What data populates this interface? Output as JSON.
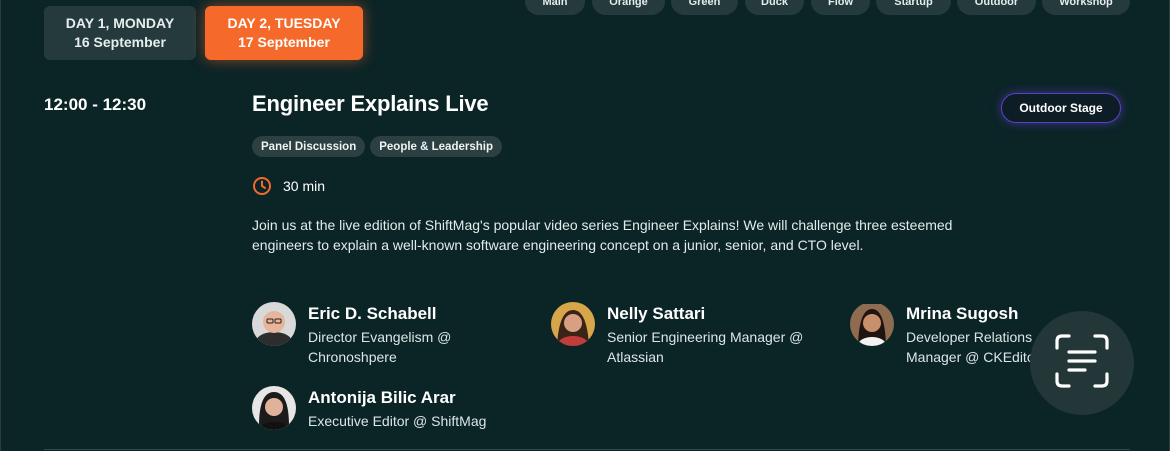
{
  "days": [
    {
      "name": "DAY 1, MONDAY",
      "date": "16 September",
      "active": false
    },
    {
      "name": "DAY 2, TUESDAY",
      "date": "17 September",
      "active": true
    }
  ],
  "stages": [
    "Main",
    "Orange",
    "Green",
    "Duck",
    "Flow",
    "Startup",
    "Outdoor",
    "Workshop"
  ],
  "session": {
    "time": "12:00 - 12:30",
    "title": "Engineer Explains Live",
    "venue": "Outdoor Stage",
    "tags": [
      "Panel Discussion",
      "People & Leadership"
    ],
    "duration": "30 min",
    "description": "Join us at the live edition of ShiftMag's popular video series Engineer Explains! We will challenge three esteemed engineers to explain a well-known software engineering concept on a junior, senior, and CTO level."
  },
  "speakers": [
    {
      "name": "Eric D. Schabell",
      "role": "Director Evangelism @ Chronoshpere"
    },
    {
      "name": "Nelly Sattari",
      "role": "Senior Engineering Manager @ Atlassian"
    },
    {
      "name": "Mrina Sugosh",
      "role": "Developer Relations Manager @ CKEditor"
    },
    {
      "name": "Antonija Bilic Arar",
      "role": "Executive Editor @ ShiftMag"
    }
  ],
  "colors": {
    "background": "#0b2426",
    "accent": "#f56a2b",
    "venue_border": "#5b3fc4"
  },
  "icons": {
    "duration": "clock-icon",
    "floating": "scan-text-icon"
  }
}
